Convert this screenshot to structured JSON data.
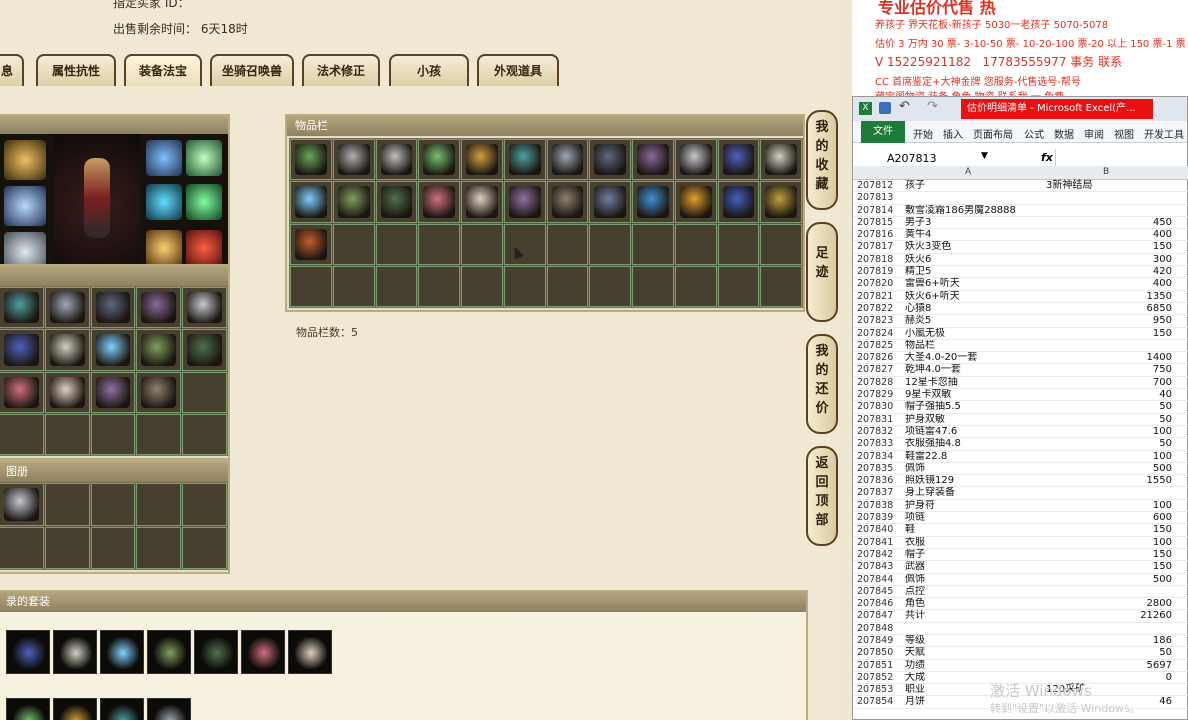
{
  "game": {
    "top_line1": "指定买家 ID：",
    "top_line2_label": "出售剩余时间：",
    "top_line2_value": "6天18时",
    "tabs": [
      "息",
      "属性抗性",
      "装备法宝",
      "坐骑召唤兽",
      "法术修正",
      "小孩",
      "外观道具"
    ],
    "active_tab": "装备法宝",
    "inventory_title": "物品栏",
    "inventory_count": "物品栏数：5",
    "left_bottom_title": "册",
    "left_bottom_title_prefix": "图",
    "suit_title": "录的套装",
    "side_buttons": [
      "我的收藏",
      "足迹",
      "我的还价",
      "返回顶部"
    ]
  },
  "ads": {
    "line1": "专业估价代售 热",
    "line2": "养孩子 界天花板-新孩子 5030一老孩子 5070-5078",
    "line3": "估价 3 万内 30 票- 3-10-50 票- 10-20-100 票-20 以上 150 票-1 票 1",
    "line4": "V 15225921182",
    "line4b": "17783555977",
    "line4c": "事务 联系",
    "line5": "CC 首席鉴定+大神金牌",
    "line5b": "您服务-代售选号-帮号",
    "line6": "藏宝阁物资 装备 角色 物资 联系我 一 免费"
  },
  "excel": {
    "title": "估价明细清单 - Microsoft Excel(产...",
    "tabs": [
      "文件",
      "开始",
      "插入",
      "页面布局",
      "公式",
      "数据",
      "审阅",
      "视图",
      "开发工具"
    ],
    "namebox": "A207813",
    "fx": "fx",
    "col_a": "A",
    "col_b": "B",
    "rows": [
      {
        "n": "207812",
        "a": "孩子",
        "b": "3新神结局",
        "bl": true
      },
      {
        "n": "207813",
        "a": "",
        "b": ""
      },
      {
        "n": "207814",
        "a": "敷雪凌霜186男魔28888",
        "b": ""
      },
      {
        "n": "207815",
        "a": "男子3",
        "b": "450"
      },
      {
        "n": "207816",
        "a": "黄牛4",
        "b": "400"
      },
      {
        "n": "207817",
        "a": "妖火3变色",
        "b": "150"
      },
      {
        "n": "207818",
        "a": "妖火6",
        "b": "300"
      },
      {
        "n": "207819",
        "a": "精卫5",
        "b": "420"
      },
      {
        "n": "207820",
        "a": "雷兽6+听天",
        "b": "400"
      },
      {
        "n": "207821",
        "a": "妖火6+听天",
        "b": "1350"
      },
      {
        "n": "207822",
        "a": "心猿8",
        "b": "6850"
      },
      {
        "n": "207823",
        "a": "赫炎5",
        "b": "950"
      },
      {
        "n": "207824",
        "a": "小嵐无极",
        "b": "150"
      },
      {
        "n": "207825",
        "a": "物品栏",
        "b": ""
      },
      {
        "n": "207826",
        "a": "大圣4.0-20一套",
        "b": "1400"
      },
      {
        "n": "207827",
        "a": "乾坤4.0一套",
        "b": "750"
      },
      {
        "n": "207828",
        "a": "12星卡忽抽",
        "b": "700"
      },
      {
        "n": "207829",
        "a": "9星卡双敏",
        "b": "40"
      },
      {
        "n": "207830",
        "a": "帽子强抽5.5",
        "b": "50"
      },
      {
        "n": "207831",
        "a": "护身双敏",
        "b": "50"
      },
      {
        "n": "207832",
        "a": "项链雷47.6",
        "b": "100"
      },
      {
        "n": "207833",
        "a": "衣服强抽4.8",
        "b": "50"
      },
      {
        "n": "207834",
        "a": "鞋雷22.8",
        "b": "100"
      },
      {
        "n": "207835",
        "a": "佩饰",
        "b": "500"
      },
      {
        "n": "207836",
        "a": "照妖镜129",
        "b": "1550"
      },
      {
        "n": "207837",
        "a": "身上穿装备",
        "b": ""
      },
      {
        "n": "207838",
        "a": "护身符",
        "b": "100"
      },
      {
        "n": "207839",
        "a": "项链",
        "b": "600"
      },
      {
        "n": "207840",
        "a": "鞋",
        "b": "150"
      },
      {
        "n": "207841",
        "a": "衣服",
        "b": "100"
      },
      {
        "n": "207842",
        "a": "帽子",
        "b": "150"
      },
      {
        "n": "207843",
        "a": "武器",
        "b": "150"
      },
      {
        "n": "207844",
        "a": "佩饰",
        "b": "500"
      },
      {
        "n": "207845",
        "a": "点控",
        "b": ""
      },
      {
        "n": "207846",
        "a": "角色",
        "b": "2800"
      },
      {
        "n": "207847",
        "a": "共计",
        "b": "21260"
      },
      {
        "n": "207848",
        "a": "",
        "b": ""
      },
      {
        "n": "207849",
        "a": "等级",
        "b": "186"
      },
      {
        "n": "207850",
        "a": "天赋",
        "b": "50"
      },
      {
        "n": "207851",
        "a": "功绩",
        "b": "5697"
      },
      {
        "n": "207852",
        "a": "大成",
        "b": "0"
      },
      {
        "n": "207853",
        "a": "职业",
        "b": "120采矿",
        "bl": true
      },
      {
        "n": "207854",
        "a": "月饼",
        "b": "46"
      }
    ],
    "watermark1": "激活 Windows",
    "watermark2": "转到\"设置\"以激活 Windows。"
  },
  "colors": {
    "accent": "#1f7b3a",
    "alert": "#e81010",
    "ad_text": "#e03020"
  }
}
